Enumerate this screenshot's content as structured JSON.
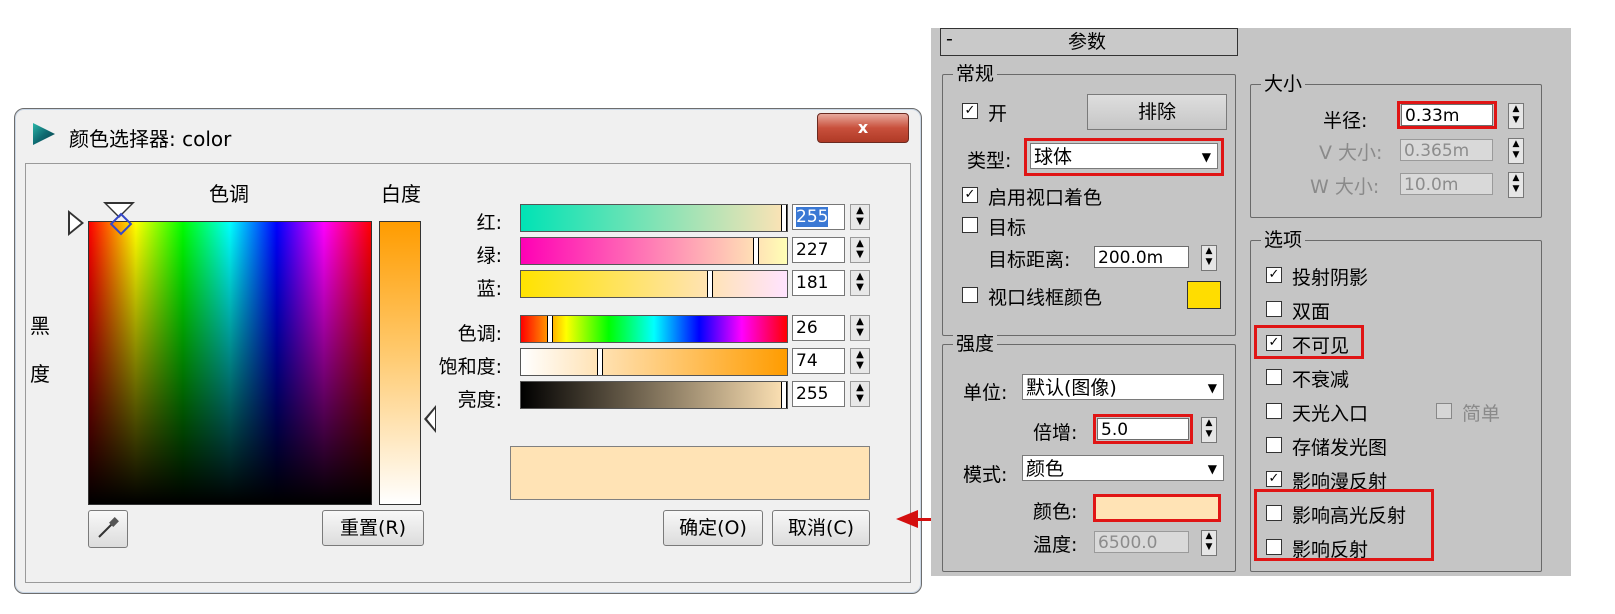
{
  "color_picker": {
    "title": "颜色选择器: color",
    "close_label": "x",
    "hue_label": "色调",
    "whiteness_label": "白度",
    "blackness_label": "黑度",
    "sliders": [
      {
        "label": "红:",
        "value": "255"
      },
      {
        "label": "绿:",
        "value": "227"
      },
      {
        "label": "蓝:",
        "value": "181"
      },
      {
        "label": "色调:",
        "value": "26"
      },
      {
        "label": "饱和度:",
        "value": "74"
      },
      {
        "label": "亮度:",
        "value": "255"
      }
    ],
    "preview_color": "#ffe3b5",
    "reset_label": "重置(R)",
    "ok_label": "确定(O)",
    "cancel_label": "取消(C)"
  },
  "params": {
    "rollout_toggle": "-",
    "rollout_title": "参数",
    "general": {
      "title": "常规",
      "on_label": "开",
      "on_checked": true,
      "exclude_label": "排除",
      "type_label": "类型:",
      "type_value": "球体",
      "viewport_shading_label": "启用视口着色",
      "target_label": "目标",
      "target_distance_label": "目标距离:",
      "target_distance_value": "200.0m",
      "wireframe_color_label": "视口线框颜色",
      "wireframe_color": "#ffdd00"
    },
    "intensity": {
      "title": "强度",
      "unit_label": "单位:",
      "unit_value": "默认(图像)",
      "multiplier_label": "倍增:",
      "multiplier_value": "5.0",
      "mode_label": "模式:",
      "mode_value": "颜色",
      "color_label": "颜色:",
      "color_value": "#ffe3b5",
      "temperature_label": "温度:",
      "temperature_value": "6500.0"
    },
    "size": {
      "title": "大小",
      "radius_label": "半径:",
      "radius_value": "0.33m",
      "v_size_label": "V 大小:",
      "v_size_value": "0.365m",
      "w_size_label": "W 大小:",
      "w_size_value": "10.0m"
    },
    "options": {
      "title": "选项",
      "cast_shadows": "投射阴影",
      "double_sided": "双面",
      "invisible": "不可见",
      "no_decay": "不衰减",
      "skylight_portal": "天光入口",
      "simple": "简单",
      "store_irradiance": "存储发光图",
      "affect_diffuse": "影响漫反射",
      "affect_specular": "影响高光反射",
      "affect_reflections": "影响反射",
      "check_mark": "✓"
    }
  }
}
